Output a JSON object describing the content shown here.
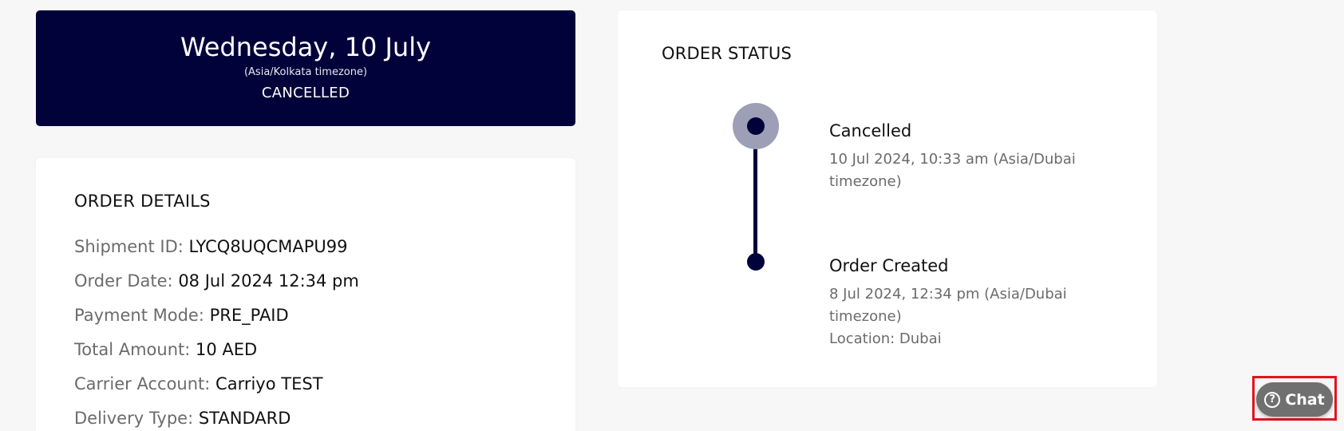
{
  "banner": {
    "date": "Wednesday, 10 July",
    "timezone": "(Asia/Kolkata timezone)",
    "status": "CANCELLED"
  },
  "order_details": {
    "title": "ORDER DETAILS",
    "rows": [
      {
        "label": "Shipment ID:",
        "value": "LYCQ8UQCMAPU99"
      },
      {
        "label": "Order Date:",
        "value": "08 Jul 2024 12:34 pm"
      },
      {
        "label": "Payment Mode:",
        "value": "PRE_PAID"
      },
      {
        "label": "Total Amount:",
        "value": "10 AED"
      },
      {
        "label": "Carrier Account:",
        "value": "Carriyo TEST"
      },
      {
        "label": "Delivery Type:",
        "value": "STANDARD"
      }
    ]
  },
  "order_status": {
    "title": "ORDER STATUS",
    "events": [
      {
        "title": "Cancelled",
        "time": "10 Jul 2024, 10:33 am (Asia/Dubai timezone)",
        "location": ""
      },
      {
        "title": "Order Created",
        "time": "8 Jul 2024, 12:34 pm (Asia/Dubai timezone)",
        "location": "Location: Dubai"
      }
    ]
  },
  "chat": {
    "label": "Chat",
    "icon": "help-circle-icon",
    "icon_glyph": "?",
    "highlight_color": "#e0151f"
  },
  "colors": {
    "brand_navy": "#01023a",
    "background": "#f7f7f7"
  }
}
